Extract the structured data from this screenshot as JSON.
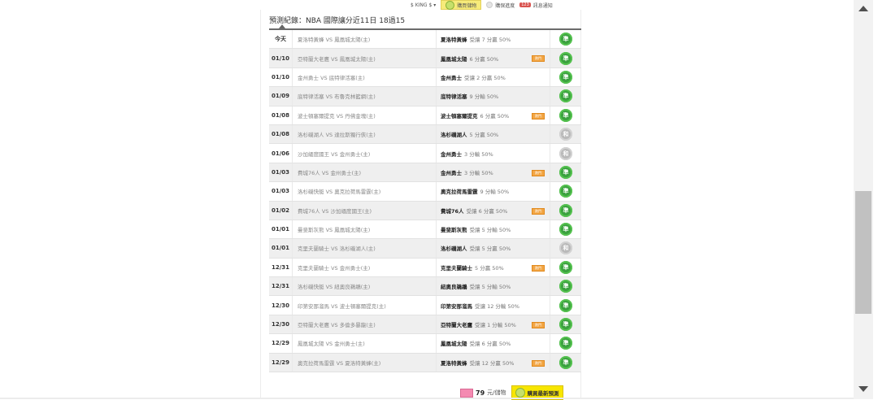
{
  "topbar": {
    "user": "$ KING $ ▾",
    "buy_label": "購買儲物",
    "storage_label": "購保進度",
    "notify_count": "123",
    "notify_label": "訊息通知"
  },
  "page": {
    "title": "預測紀錄：NBA 國際讓分近11日 18過15"
  },
  "rows": [
    {
      "date": "今天",
      "match": "夏洛特黃蜂 VS 鳳凰城太陽(主)",
      "pick_team": "夏洛特黃蜂",
      "pick_desc": "受讓 7 分贏 50%",
      "tag": "",
      "result": "準"
    },
    {
      "date": "01/10",
      "match": "亞特蘭大老鷹 VS 鳳凰城太陽(主)",
      "pick_team": "鳳凰城太陽",
      "pick_desc": "6 分贏 50%",
      "tag": "熱門",
      "result": "準"
    },
    {
      "date": "01/10",
      "match": "金州勇士 VS 底特律活塞(主)",
      "pick_team": "金州勇士",
      "pick_desc": "受讓 2 分贏 50%",
      "tag": "",
      "result": "準"
    },
    {
      "date": "01/09",
      "match": "底特律活塞 VS 布魯克林籃網(主)",
      "pick_team": "底特律活塞",
      "pick_desc": "9 分輸 50%",
      "tag": "",
      "result": "準"
    },
    {
      "date": "01/08",
      "match": "波士頓塞爾提克 VS 丹佛金塊(主)",
      "pick_team": "波士頓塞爾提克",
      "pick_desc": "6 分贏 50%",
      "tag": "熱門",
      "result": "準"
    },
    {
      "date": "01/08",
      "match": "洛杉磯湖人 VS 達拉斯獨行俠(主)",
      "pick_team": "洛杉磯湖人",
      "pick_desc": "5 分贏 50%",
      "tag": "",
      "result": "和"
    },
    {
      "date": "01/06",
      "match": "沙加緬度國王 VS 金州勇士(主)",
      "pick_team": "金州勇士",
      "pick_desc": "3 分輸 50%",
      "tag": "",
      "result": "和"
    },
    {
      "date": "01/03",
      "match": "費城76人 VS 金州勇士(主)",
      "pick_team": "金州勇士",
      "pick_desc": "3 分輸 50%",
      "tag": "熱門",
      "result": "準"
    },
    {
      "date": "01/03",
      "match": "洛杉磯快艇 VS 奧克拉荷馬雷霆(主)",
      "pick_team": "奧克拉荷馬雷霆",
      "pick_desc": "9 分輸 50%",
      "tag": "",
      "result": "準"
    },
    {
      "date": "01/02",
      "match": "費城76人 VS 沙加緬度國王(主)",
      "pick_team": "費城76人",
      "pick_desc": "受讓 6 分贏 50%",
      "tag": "熱門",
      "result": "準"
    },
    {
      "date": "01/01",
      "match": "曼斐斯灰熊 VS 鳳凰城太陽(主)",
      "pick_team": "曼斐斯灰熊",
      "pick_desc": "受讓 5 分輸 50%",
      "tag": "",
      "result": "準"
    },
    {
      "date": "01/01",
      "match": "克里夫蘭騎士 VS 洛杉磯湖人(主)",
      "pick_team": "洛杉磯湖人",
      "pick_desc": "受讓 5 分贏 50%",
      "tag": "",
      "result": "和"
    },
    {
      "date": "12/31",
      "match": "克里夫蘭騎士 VS 金州勇士(主)",
      "pick_team": "克里夫蘭騎士",
      "pick_desc": "5 分贏 50%",
      "tag": "熱門",
      "result": "準"
    },
    {
      "date": "12/31",
      "match": "洛杉磯快艇 VS 紐奧良鵜鶘(主)",
      "pick_team": "紐奧良鵜鶘",
      "pick_desc": "受讓 5 分輸 50%",
      "tag": "",
      "result": "準"
    },
    {
      "date": "12/30",
      "match": "印第安那溜馬 VS 波士頓塞爾提克(主)",
      "pick_team": "印第安那溜馬",
      "pick_desc": "受讓 12 分輸 50%",
      "tag": "",
      "result": "準"
    },
    {
      "date": "12/30",
      "match": "亞特蘭大老鷹 VS 多倫多暴龍(主)",
      "pick_team": "亞特蘭大老鷹",
      "pick_desc": "受讓 1 分輸 50%",
      "tag": "熱門",
      "result": "準"
    },
    {
      "date": "12/29",
      "match": "鳳凰城太陽 VS 金州勇士(主)",
      "pick_team": "鳳凰城太陽",
      "pick_desc": "受讓 6 分贏 50%",
      "tag": "",
      "result": "準"
    },
    {
      "date": "12/29",
      "match": "奧克拉荷馬雷霆 VS 夏洛特黃蜂(主)",
      "pick_team": "夏洛特黃蜂",
      "pick_desc": "受讓 12 分贏 50%",
      "tag": "熱門",
      "result": "準"
    }
  ],
  "footer": {
    "price_value": "79",
    "price_unit": "元/儲物",
    "price_icon": "儲值",
    "buy_button": "購買最新預測"
  },
  "colors": {
    "win": "#3aa13e",
    "tie": "#b9b9b9",
    "hot": "#f3a644",
    "buy": "#f7e600"
  }
}
